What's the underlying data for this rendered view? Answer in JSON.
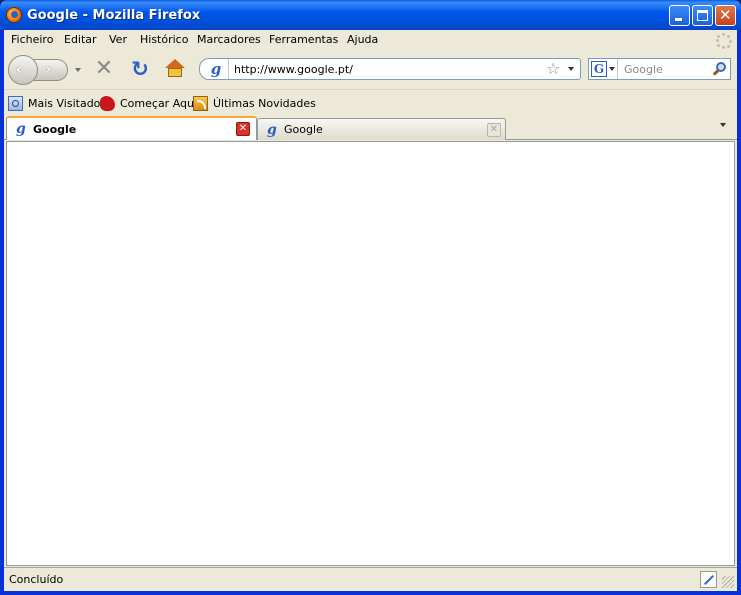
{
  "window": {
    "title": "Google - Mozilla Firefox"
  },
  "menu": {
    "items": [
      {
        "label": "Ficheiro"
      },
      {
        "label": "Editar"
      },
      {
        "label": "Ver"
      },
      {
        "label": "Histórico"
      },
      {
        "label": "Marcadores"
      },
      {
        "label": "Ferramentas"
      },
      {
        "label": "Ajuda"
      }
    ]
  },
  "navigation": {
    "url": "http://www.google.pt/",
    "search_engine_glyph": "G",
    "search_placeholder": "Google"
  },
  "bookmarks": {
    "items": [
      {
        "label": "Mais Visitados",
        "icon": "most-visited-icon"
      },
      {
        "label": "Começar Aqui",
        "icon": "getting-started-icon"
      },
      {
        "label": "Últimas Novidades",
        "icon": "rss-feed-icon"
      }
    ]
  },
  "tabs": [
    {
      "label": "Google",
      "active": true,
      "favicon": "g"
    },
    {
      "label": "Google",
      "active": false,
      "favicon": "g"
    }
  ],
  "status": {
    "text": "Concluído"
  },
  "colors": {
    "titlebar": "#0058ee",
    "chrome": "#ece9d8",
    "active_tab_accent": "#f8a838",
    "tab_close_active": "#d8322a"
  }
}
